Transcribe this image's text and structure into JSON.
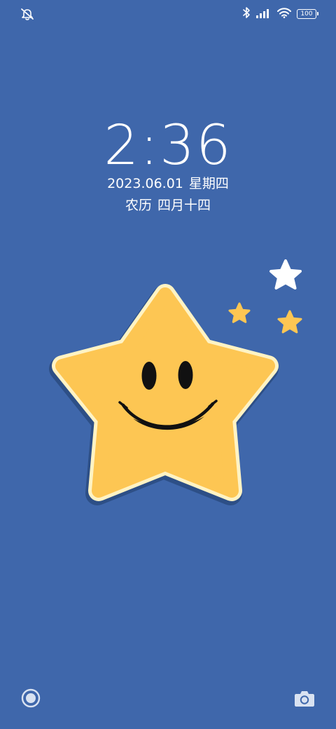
{
  "status_bar": {
    "left_icon": "muted-bell-icon",
    "bluetooth_icon": "bluetooth-icon",
    "signal_icon": "signal-icon",
    "wifi_icon": "wifi-icon",
    "battery_level": "100"
  },
  "lock_screen": {
    "time": "2:36",
    "date": "2023.06.01",
    "weekday": "星期四",
    "lunar_label": "农历",
    "lunar_date": "四月十四"
  },
  "wallpaper": {
    "description_icon": "smiling-star-icon",
    "colors": {
      "background": "#3f67ab",
      "star_fill": "#fdc653",
      "star_outline": "#fff3c4",
      "small_star_yellow": "#fdc653",
      "small_star_white": "#ffffff"
    }
  },
  "shortcuts": {
    "left_icon": "assistant-icon",
    "right_icon": "camera-icon"
  }
}
